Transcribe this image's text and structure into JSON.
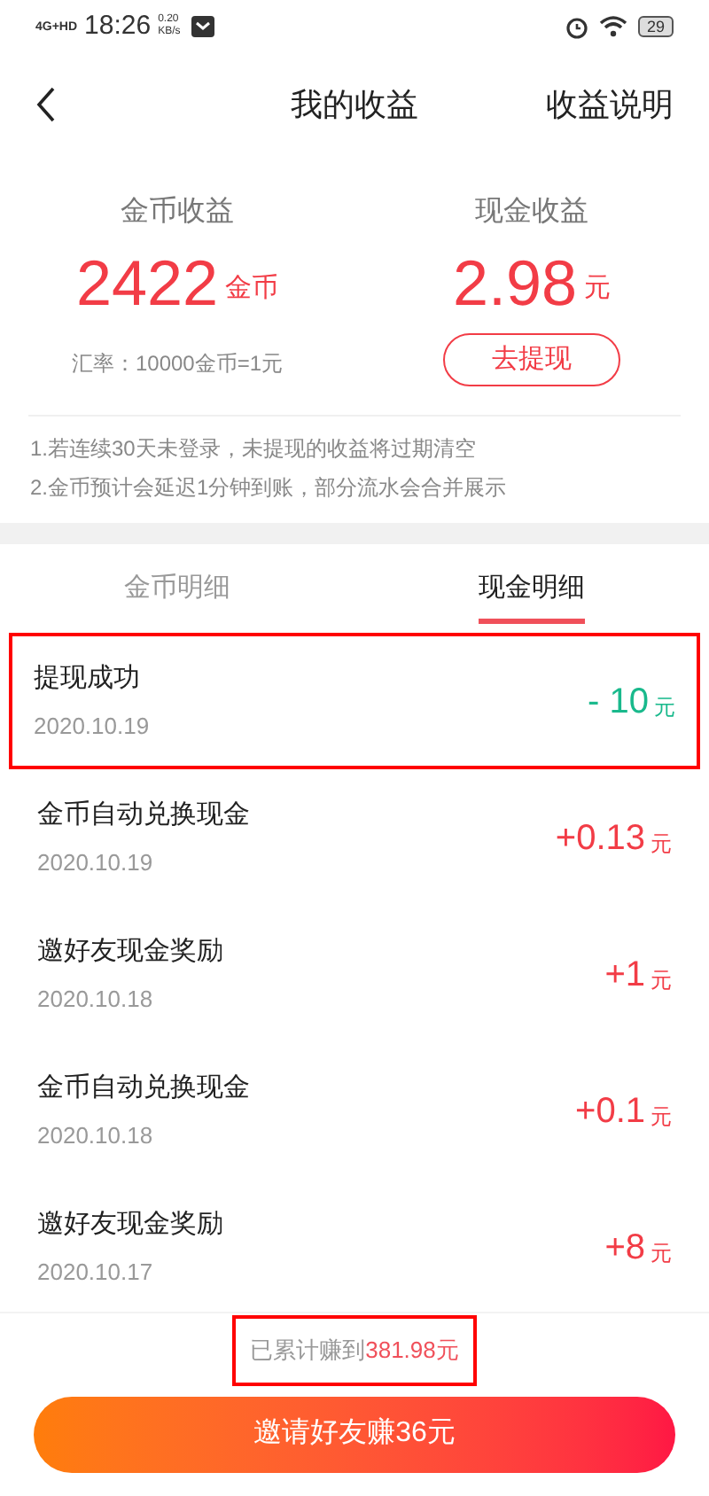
{
  "status_bar": {
    "network": "4G+HD",
    "time": "18:26",
    "speed_value": "0.20",
    "speed_unit": "KB/s",
    "battery": "29"
  },
  "header": {
    "title": "我的收益",
    "action": "收益说明"
  },
  "summary": [
    {
      "label": "金币收益",
      "amount": "2422",
      "unit": "金币",
      "kind": "coins",
      "note": "汇率：10000金币=1元"
    },
    {
      "label": "现金收益",
      "amount": "2.98",
      "unit": "元",
      "kind": "cash",
      "button": "去提现"
    }
  ],
  "notes": [
    "1.若连续30天未登录，未提现的收益将过期清空",
    "2.金币预计会延迟1分钟到账，部分流水会合并展示"
  ],
  "tabs": [
    {
      "label": "金币明细",
      "selected": false
    },
    {
      "label": "现金明细",
      "selected": true
    }
  ],
  "transactions": [
    {
      "title": "提现成功",
      "date": "2020.10.19",
      "amount": "- 10",
      "unit": "元",
      "kind": "debit",
      "highlighted": true
    },
    {
      "title": "金币自动兑换现金",
      "date": "2020.10.19",
      "amount": "+0.13",
      "unit": "元",
      "kind": "credit",
      "highlighted": false
    },
    {
      "title": "邀好友现金奖励",
      "date": "2020.10.18",
      "amount": "+1",
      "unit": "元",
      "kind": "credit",
      "highlighted": false
    },
    {
      "title": "金币自动兑换现金",
      "date": "2020.10.18",
      "amount": "+0.1",
      "unit": "元",
      "kind": "credit",
      "highlighted": false
    },
    {
      "title": "邀好友现金奖励",
      "date": "2020.10.17",
      "amount": "+8",
      "unit": "元",
      "kind": "credit",
      "highlighted": false
    }
  ],
  "total": {
    "label": "已累计赚到",
    "value": "381.98元",
    "highlighted": true
  },
  "invite_button": "邀请好友赚36元"
}
